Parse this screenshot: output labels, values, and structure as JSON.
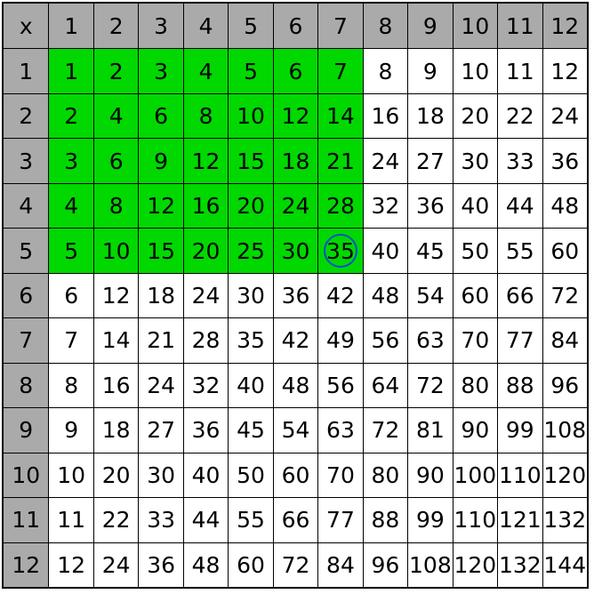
{
  "chart_data": {
    "type": "table",
    "title": "",
    "corner_label": "x",
    "col_headers": [
      1,
      2,
      3,
      4,
      5,
      6,
      7,
      8,
      9,
      10,
      11,
      12
    ],
    "row_headers": [
      1,
      2,
      3,
      4,
      5,
      6,
      7,
      8,
      9,
      10,
      11,
      12
    ],
    "cells": [
      [
        1,
        2,
        3,
        4,
        5,
        6,
        7,
        8,
        9,
        10,
        11,
        12
      ],
      [
        2,
        4,
        6,
        8,
        10,
        12,
        14,
        16,
        18,
        20,
        22,
        24
      ],
      [
        3,
        6,
        9,
        12,
        15,
        18,
        21,
        24,
        27,
        30,
        33,
        36
      ],
      [
        4,
        8,
        12,
        16,
        20,
        24,
        28,
        32,
        36,
        40,
        44,
        48
      ],
      [
        5,
        10,
        15,
        20,
        25,
        30,
        35,
        40,
        45,
        50,
        55,
        60
      ],
      [
        6,
        12,
        18,
        24,
        30,
        36,
        42,
        48,
        54,
        60,
        66,
        72
      ],
      [
        7,
        14,
        21,
        28,
        35,
        42,
        49,
        56,
        63,
        70,
        77,
        84
      ],
      [
        8,
        16,
        24,
        32,
        40,
        48,
        56,
        64,
        72,
        80,
        88,
        96
      ],
      [
        9,
        18,
        27,
        36,
        45,
        54,
        63,
        72,
        81,
        90,
        99,
        108
      ],
      [
        10,
        20,
        30,
        40,
        50,
        60,
        70,
        80,
        90,
        100,
        110,
        120
      ],
      [
        11,
        22,
        33,
        44,
        55,
        66,
        77,
        88,
        99,
        110,
        121,
        132
      ],
      [
        12,
        24,
        36,
        48,
        60,
        72,
        84,
        96,
        108,
        120,
        132,
        144
      ]
    ],
    "highlight": {
      "rows": [
        1,
        5
      ],
      "cols": [
        1,
        7
      ],
      "color": "#00d800"
    },
    "circled": {
      "row": 5,
      "col": 7,
      "color": "#0050c8"
    }
  }
}
